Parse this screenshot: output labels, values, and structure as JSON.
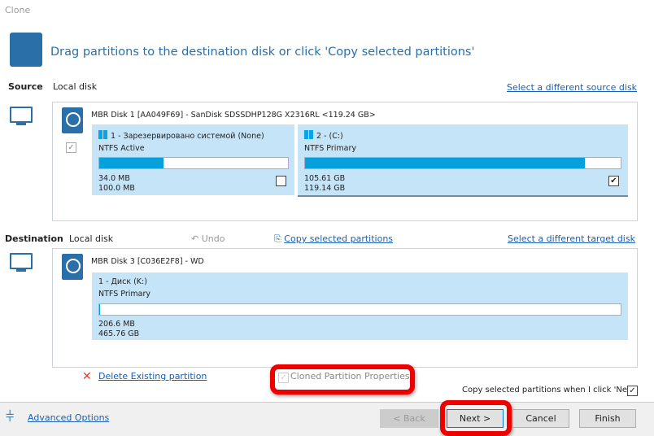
{
  "window": {
    "title": "Clone"
  },
  "header": {
    "text": "Drag partitions to the destination disk or click 'Copy selected partitions'"
  },
  "source": {
    "label": "Source",
    "disk_type": "Local disk",
    "select_link": "Select a different source disk",
    "disk_title": "MBR Disk 1 [AA049F69] - SanDisk SDSSDHP128G X2316RL  <119.24 GB>",
    "disk_checked": true,
    "partitions": [
      {
        "name": "1 - Зарезервировано системой (None)",
        "type": "NTFS Active",
        "used": "34.0 MB",
        "total": "100.0 MB",
        "usage_fraction": 0.34,
        "checked": false
      },
      {
        "name": "2 -  (C:)",
        "type": "NTFS Primary",
        "used": "105.61 GB",
        "total": "119.14 GB",
        "usage_fraction": 0.886,
        "checked": true
      }
    ]
  },
  "destination": {
    "label": "Destination",
    "disk_type": "Local disk",
    "undo": "Undo",
    "copy_link": "Copy selected partitions",
    "select_link": "Select a different target disk",
    "disk_title": "MBR Disk 3 [C036E2F8] - WD",
    "partitions": [
      {
        "name": "1 - Диск (K:)",
        "type": "NTFS Primary",
        "used": "206.6 MB",
        "total": "465.76 GB",
        "usage_fraction": 0.0
      }
    ]
  },
  "actions": {
    "delete_link": "Delete Existing partition",
    "cloned_props": "Cloned Partition Properties",
    "copy_on_next": "Copy selected partitions when I click 'Next'",
    "copy_on_next_checked": true
  },
  "footer": {
    "advanced": "Advanced Options",
    "back": "< Back",
    "next": "Next >",
    "cancel": "Cancel",
    "finish": "Finish"
  },
  "colors": {
    "accent": "#06a0dc",
    "highlight": "#e00000",
    "link": "#1a5fb4"
  }
}
